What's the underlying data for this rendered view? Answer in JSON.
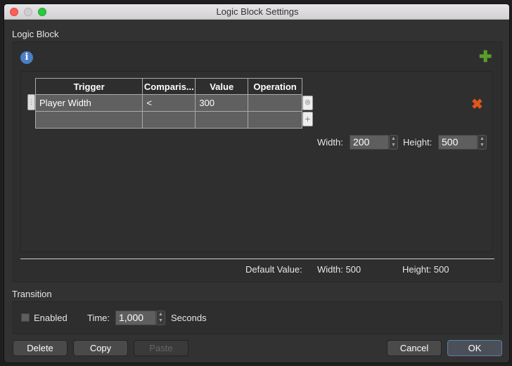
{
  "window": {
    "title": "Logic Block Settings"
  },
  "logic_block": {
    "label": "Logic Block",
    "table": {
      "columns": [
        "Trigger",
        "Comparis...",
        "Value",
        "Operation"
      ],
      "rows": [
        [
          "Player Width",
          "<",
          "300",
          ""
        ],
        [
          "",
          "",
          "",
          ""
        ]
      ]
    },
    "width_label": "Width:",
    "width_value": "200",
    "height_label": "Height:",
    "height_value": "500",
    "default_label": "Default Value:",
    "default_width": "Width:  500",
    "default_height": "Height:  500"
  },
  "transition": {
    "label": "Transition",
    "enabled_label": "Enabled",
    "enabled": false,
    "time_label": "Time:",
    "time_value": "1,000",
    "unit": "Seconds"
  },
  "buttons": {
    "delete": "Delete",
    "copy": "Copy",
    "paste": "Paste",
    "cancel": "Cancel",
    "ok": "OK"
  },
  "colors": {
    "add": "#5a9e2a",
    "remove": "#e0561c",
    "info": "#4a7fc8"
  }
}
